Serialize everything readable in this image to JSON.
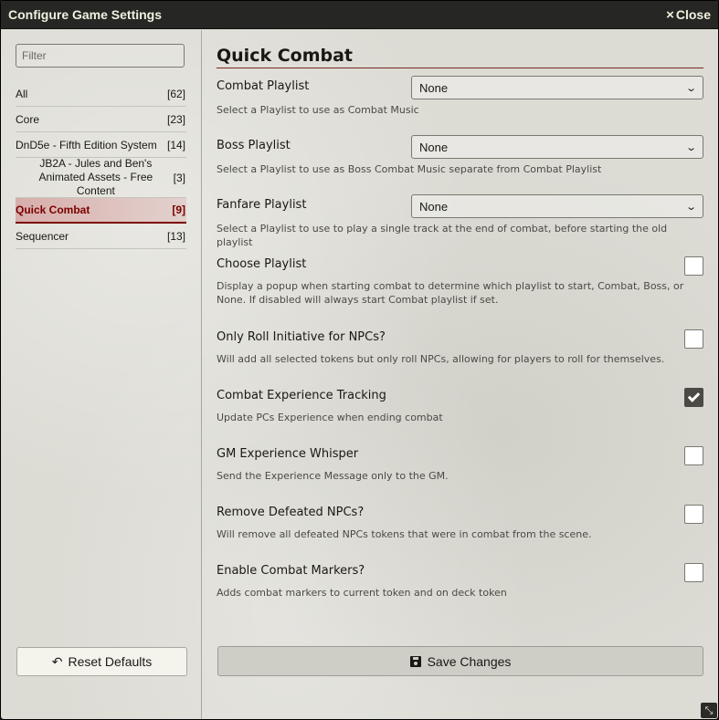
{
  "window": {
    "title": "Configure Game Settings",
    "close_label": "Close",
    "close_icon": "×"
  },
  "sidebar": {
    "filter_placeholder": "Filter",
    "categories": [
      {
        "name": "All",
        "count": "[62]"
      },
      {
        "name": "Core",
        "count": "[23]"
      },
      {
        "name": "DnD5e - Fifth Edition System",
        "count": "[14]"
      },
      {
        "name": "JB2A - Jules and Ben's Animated Assets - Free Content",
        "count": "[3]"
      },
      {
        "name": "Quick Combat",
        "count": "[9]",
        "active": true
      },
      {
        "name": "Sequencer",
        "count": "[13]"
      }
    ],
    "reset_label": "Reset Defaults",
    "reset_icon": "↶"
  },
  "main": {
    "section_title": "Quick Combat",
    "settings": [
      {
        "label": "Combat Playlist",
        "type": "select",
        "value": "None",
        "hint": "Select a Playlist to use as Combat Music"
      },
      {
        "label": "Boss Playlist",
        "type": "select",
        "value": "None",
        "hint": "Select a Playlist to use as Boss Combat Music separate from Combat Playlist"
      },
      {
        "label": "Fanfare Playlist",
        "type": "select",
        "value": "None",
        "hint": "Select a Playlist to use to play a single track at the end of combat, before starting the old playlist"
      },
      {
        "label": "Choose Playlist",
        "type": "checkbox",
        "checked": false,
        "hint": "Display a popup when starting combat to determine which playlist to start, Combat, Boss, or None. If disabled will always start Combat playlist if set."
      },
      {
        "label": "Only Roll Initiative for NPCs?",
        "type": "checkbox",
        "checked": false,
        "hint": "Will add all selected tokens but only roll NPCs, allowing for players to roll for themselves."
      },
      {
        "label": "Combat Experience Tracking",
        "type": "checkbox",
        "checked": true,
        "hint": "Update PCs Experience when ending combat"
      },
      {
        "label": "GM Experience Whisper",
        "type": "checkbox",
        "checked": false,
        "hint": "Send the Experience Message only to the GM."
      },
      {
        "label": "Remove Defeated NPCs?",
        "type": "checkbox",
        "checked": false,
        "hint": "Will remove all defeated NPCs tokens that were in combat from the scene."
      },
      {
        "label": "Enable Combat Markers?",
        "type": "checkbox",
        "checked": false,
        "hint": "Adds combat markers to current token and on deck token"
      }
    ],
    "save_label": "Save Changes"
  },
  "icons": {
    "chevron": "chevron-down-icon",
    "floppy": "floppy-disk-icon",
    "resize": "resize-handle-icon",
    "resize_glyph": "⤡"
  }
}
